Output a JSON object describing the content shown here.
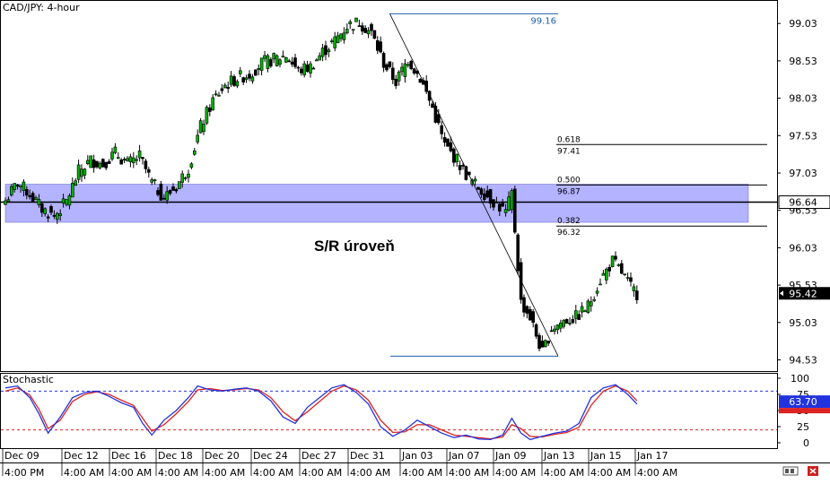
{
  "chart_title": "CAD/JPY: 4-hour",
  "sr_label": "S/R úroveň",
  "stoch_title": "Stochastic",
  "footer_icons": [
    "scroll-icon",
    "close-icon"
  ],
  "colors": {
    "zone": "#8080ff",
    "fib_swing": "#1f5fb0",
    "fib_level": "#000000",
    "stoch_k": "#2233dd",
    "stoch_d": "#dd2222",
    "stoch_high": "#2233dd",
    "stoch_low": "#dd2222",
    "current_bg": "#000000",
    "stoch_badge1": "#2233dd",
    "stoch_badge2": "#dd2222"
  },
  "chart_data": {
    "type": "candlestick",
    "title": "CAD/JPY: 4-hour",
    "ylim": [
      94.38,
      99.32
    ],
    "y_ticks": [
      99.03,
      98.53,
      98.03,
      97.53,
      97.03,
      96.53,
      96.03,
      95.53,
      95.03,
      94.53
    ],
    "x_date_labels": [
      "Dec 09",
      "Dec 12",
      "Dec 16",
      "Dec 18",
      "Dec 20",
      "Dec 24",
      "Dec 27",
      "Dec 31",
      "Jan 03",
      "Jan 07",
      "Jan 09",
      "Jan 13",
      "Jan 15",
      "Jan 17"
    ],
    "x_time_labels": [
      "4:00 PM",
      "4:00 AM",
      "4:00 AM",
      "4:00 AM",
      "4:00 AM",
      "4:00 AM",
      "4:00 AM",
      "4:00 AM",
      "4:00 AM",
      "4:00 AM",
      "4:00 AM",
      "4:00 AM",
      "4:00 AM",
      "4:00 AM"
    ],
    "current_price": "95.42",
    "sr_zone": [
      96.37,
      96.88
    ],
    "sr_line": 96.64,
    "sr_line_label": "96.64",
    "fib_high": {
      "label": "99.16",
      "value": 99.16
    },
    "fib_low": 94.58,
    "fib_levels": [
      {
        "ratio": "0.618",
        "value": "97.41"
      },
      {
        "ratio": "0.500",
        "value": "96.87"
      },
      {
        "ratio": "0.382",
        "value": "96.32"
      }
    ],
    "close_path": [
      [
        0,
        96.66
      ],
      [
        4,
        96.9
      ],
      [
        8,
        96.75
      ],
      [
        12,
        96.55
      ],
      [
        16,
        96.45
      ],
      [
        20,
        96.65
      ],
      [
        24,
        97.05
      ],
      [
        28,
        97.2
      ],
      [
        32,
        97.15
      ],
      [
        36,
        97.3
      ],
      [
        40,
        97.15
      ],
      [
        44,
        97.25
      ],
      [
        48,
        96.9
      ],
      [
        52,
        96.7
      ],
      [
        56,
        96.85
      ],
      [
        60,
        97.1
      ],
      [
        64,
        97.65
      ],
      [
        68,
        98.0
      ],
      [
        72,
        98.2
      ],
      [
        76,
        98.3
      ],
      [
        80,
        98.35
      ],
      [
        84,
        98.5
      ],
      [
        88,
        98.55
      ],
      [
        92,
        98.6
      ],
      [
        96,
        98.4
      ],
      [
        100,
        98.45
      ],
      [
        104,
        98.65
      ],
      [
        108,
        98.8
      ],
      [
        112,
        99.0
      ],
      [
        116,
        99.05
      ],
      [
        120,
        98.9
      ],
      [
        124,
        98.5
      ],
      [
        128,
        98.25
      ],
      [
        132,
        98.55
      ],
      [
        136,
        98.3
      ],
      [
        140,
        97.9
      ],
      [
        144,
        97.4
      ],
      [
        148,
        97.2
      ],
      [
        152,
        96.95
      ],
      [
        156,
        96.8
      ],
      [
        160,
        96.65
      ],
      [
        164,
        96.5
      ],
      [
        166,
        96.75
      ],
      [
        169,
        95.3
      ],
      [
        172,
        95.1
      ],
      [
        176,
        94.62
      ],
      [
        179,
        94.95
      ],
      [
        183,
        95.05
      ],
      [
        187,
        95.1
      ],
      [
        191,
        95.25
      ],
      [
        195,
        95.6
      ],
      [
        199,
        95.85
      ],
      [
        202,
        95.7
      ],
      [
        205,
        95.5
      ],
      [
        207,
        95.42
      ]
    ],
    "stochastic": {
      "levels": [
        20,
        80
      ],
      "y_ticks": [
        100,
        75,
        50,
        25,
        0
      ],
      "badge_values": [
        "63.70",
        "56.80"
      ],
      "k_path": [
        [
          0,
          85
        ],
        [
          4,
          88
        ],
        [
          8,
          70
        ],
        [
          11,
          45
        ],
        [
          14,
          15
        ],
        [
          18,
          40
        ],
        [
          22,
          70
        ],
        [
          26,
          78
        ],
        [
          30,
          80
        ],
        [
          34,
          72
        ],
        [
          38,
          62
        ],
        [
          42,
          55
        ],
        [
          45,
          30
        ],
        [
          48,
          12
        ],
        [
          52,
          35
        ],
        [
          56,
          50
        ],
        [
          60,
          70
        ],
        [
          63,
          88
        ],
        [
          67,
          82
        ],
        [
          71,
          80
        ],
        [
          75,
          83
        ],
        [
          79,
          85
        ],
        [
          83,
          80
        ],
        [
          87,
          65
        ],
        [
          91,
          40
        ],
        [
          95,
          30
        ],
        [
          99,
          55
        ],
        [
          103,
          70
        ],
        [
          107,
          85
        ],
        [
          111,
          90
        ],
        [
          115,
          78
        ],
        [
          119,
          60
        ],
        [
          123,
          25
        ],
        [
          127,
          10
        ],
        [
          131,
          20
        ],
        [
          135,
          35
        ],
        [
          139,
          25
        ],
        [
          143,
          15
        ],
        [
          147,
          8
        ],
        [
          151,
          12
        ],
        [
          155,
          6
        ],
        [
          159,
          5
        ],
        [
          163,
          12
        ],
        [
          166,
          38
        ],
        [
          169,
          15
        ],
        [
          172,
          5
        ],
        [
          176,
          10
        ],
        [
          180,
          15
        ],
        [
          184,
          18
        ],
        [
          188,
          30
        ],
        [
          192,
          70
        ],
        [
          196,
          85
        ],
        [
          200,
          90
        ],
        [
          204,
          75
        ],
        [
          207,
          60
        ]
      ],
      "d_path": [
        [
          0,
          80
        ],
        [
          4,
          85
        ],
        [
          8,
          74
        ],
        [
          11,
          52
        ],
        [
          14,
          22
        ],
        [
          18,
          35
        ],
        [
          22,
          64
        ],
        [
          26,
          75
        ],
        [
          30,
          79
        ],
        [
          34,
          75
        ],
        [
          38,
          66
        ],
        [
          42,
          58
        ],
        [
          45,
          38
        ],
        [
          48,
          18
        ],
        [
          52,
          28
        ],
        [
          56,
          45
        ],
        [
          60,
          64
        ],
        [
          63,
          82
        ],
        [
          67,
          84
        ],
        [
          71,
          81
        ],
        [
          75,
          82
        ],
        [
          79,
          84
        ],
        [
          83,
          82
        ],
        [
          87,
          70
        ],
        [
          91,
          48
        ],
        [
          95,
          34
        ],
        [
          99,
          48
        ],
        [
          103,
          64
        ],
        [
          107,
          80
        ],
        [
          111,
          88
        ],
        [
          115,
          82
        ],
        [
          119,
          66
        ],
        [
          123,
          35
        ],
        [
          127,
          16
        ],
        [
          131,
          17
        ],
        [
          135,
          28
        ],
        [
          139,
          28
        ],
        [
          143,
          20
        ],
        [
          147,
          12
        ],
        [
          151,
          10
        ],
        [
          155,
          8
        ],
        [
          159,
          6
        ],
        [
          163,
          9
        ],
        [
          166,
          28
        ],
        [
          169,
          22
        ],
        [
          172,
          10
        ],
        [
          176,
          9
        ],
        [
          180,
          13
        ],
        [
          184,
          16
        ],
        [
          188,
          24
        ],
        [
          192,
          58
        ],
        [
          196,
          80
        ],
        [
          200,
          88
        ],
        [
          204,
          80
        ],
        [
          207,
          65
        ]
      ]
    }
  }
}
